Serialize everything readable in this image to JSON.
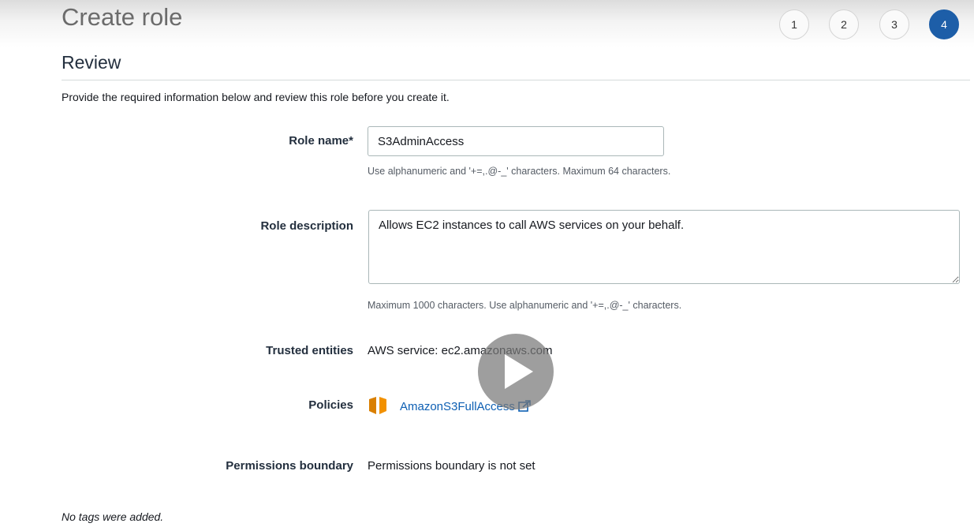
{
  "header": {
    "title": "Create role",
    "steps": [
      "1",
      "2",
      "3",
      "4"
    ],
    "active_step": "4"
  },
  "review": {
    "title": "Review",
    "intro": "Provide the required information below and review this role before you create it."
  },
  "form": {
    "role_name_label": "Role name*",
    "role_name_value": "S3AdminAccess",
    "role_name_hint": "Use alphanumeric and '+=,.@-_' characters. Maximum 64 characters.",
    "role_description_label": "Role description",
    "role_description_value": "Allows EC2 instances to call AWS services on your behalf.",
    "role_description_hint": "Maximum 1000 characters. Use alphanumeric and '+=,.@-_' characters.",
    "trusted_entities_label": "Trusted entities",
    "trusted_entities_value": "AWS service: ec2.amazonaws.com",
    "policies_label": "Policies",
    "policy_name": "AmazonS3FullAccess",
    "permissions_boundary_label": "Permissions boundary",
    "permissions_boundary_value": "Permissions boundary is not set"
  },
  "tags_note": "No tags were added.",
  "icons": {
    "policy": "aws-policy-box-icon",
    "external": "external-link-icon",
    "play": "play-icon"
  },
  "colors": {
    "accent": "#1d5ea8",
    "link": "#0d5fb3",
    "policy_icon": "#f29100"
  }
}
